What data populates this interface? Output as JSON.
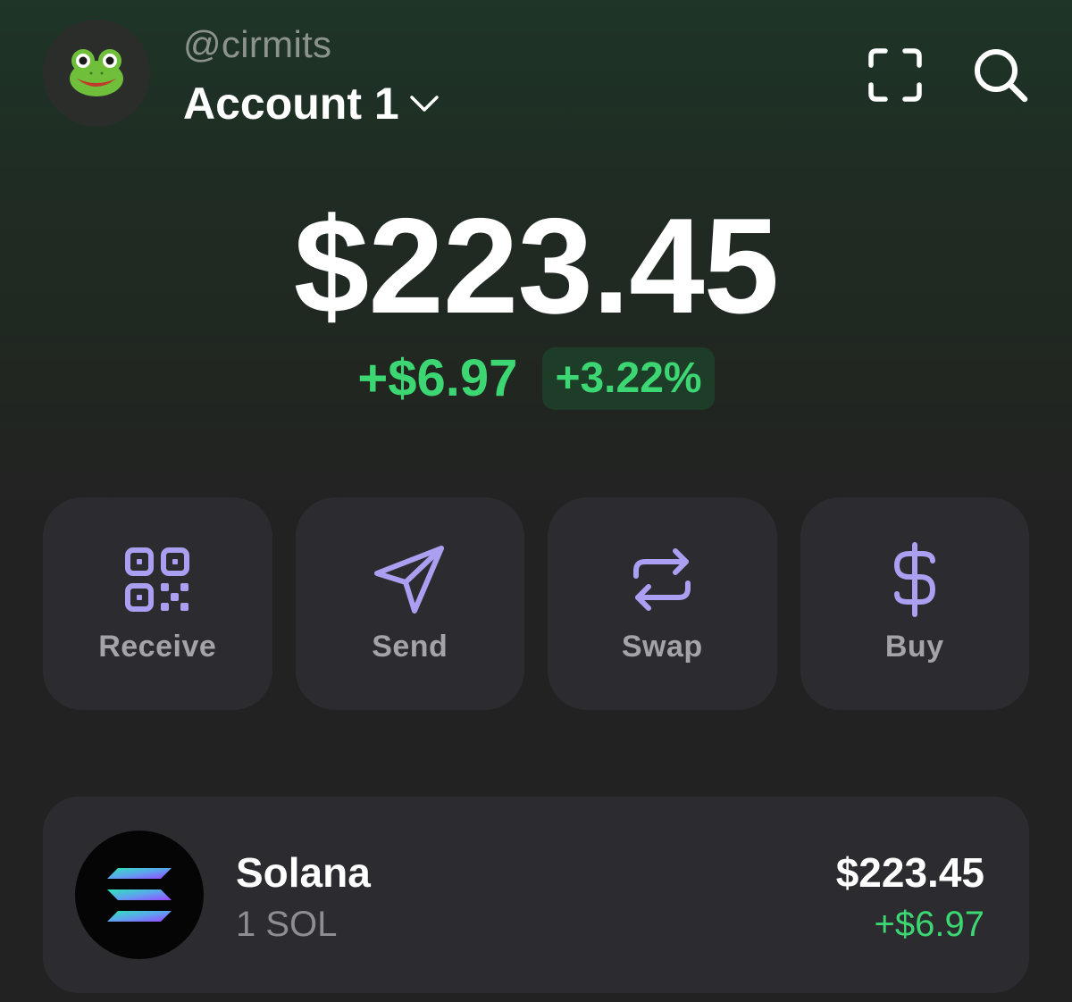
{
  "header": {
    "username": "@cirmits",
    "account_name": "Account 1"
  },
  "icons": {
    "avatar": "frog-emoji",
    "account_switch": "chevron-down-icon",
    "scan": "scan-icon",
    "search": "search-icon",
    "receive": "qr-code-icon",
    "send": "paper-plane-icon",
    "swap": "swap-arrows-icon",
    "buy": "dollar-icon",
    "token": "solana-logo"
  },
  "balance": {
    "total": "$223.45",
    "change_amount": "+$6.97",
    "change_percent": "+3.22%"
  },
  "actions": [
    {
      "label": "Receive"
    },
    {
      "label": "Send"
    },
    {
      "label": "Swap"
    },
    {
      "label": "Buy"
    }
  ],
  "tokens": [
    {
      "name": "Solana",
      "amount": "1 SOL",
      "value": "$223.45",
      "change": "+$6.97"
    }
  ],
  "colors": {
    "accent_purple": "#ab9ff2",
    "positive_green": "#3cd673",
    "card_bg": "#2c2c30",
    "header_green": "#1e3527"
  }
}
